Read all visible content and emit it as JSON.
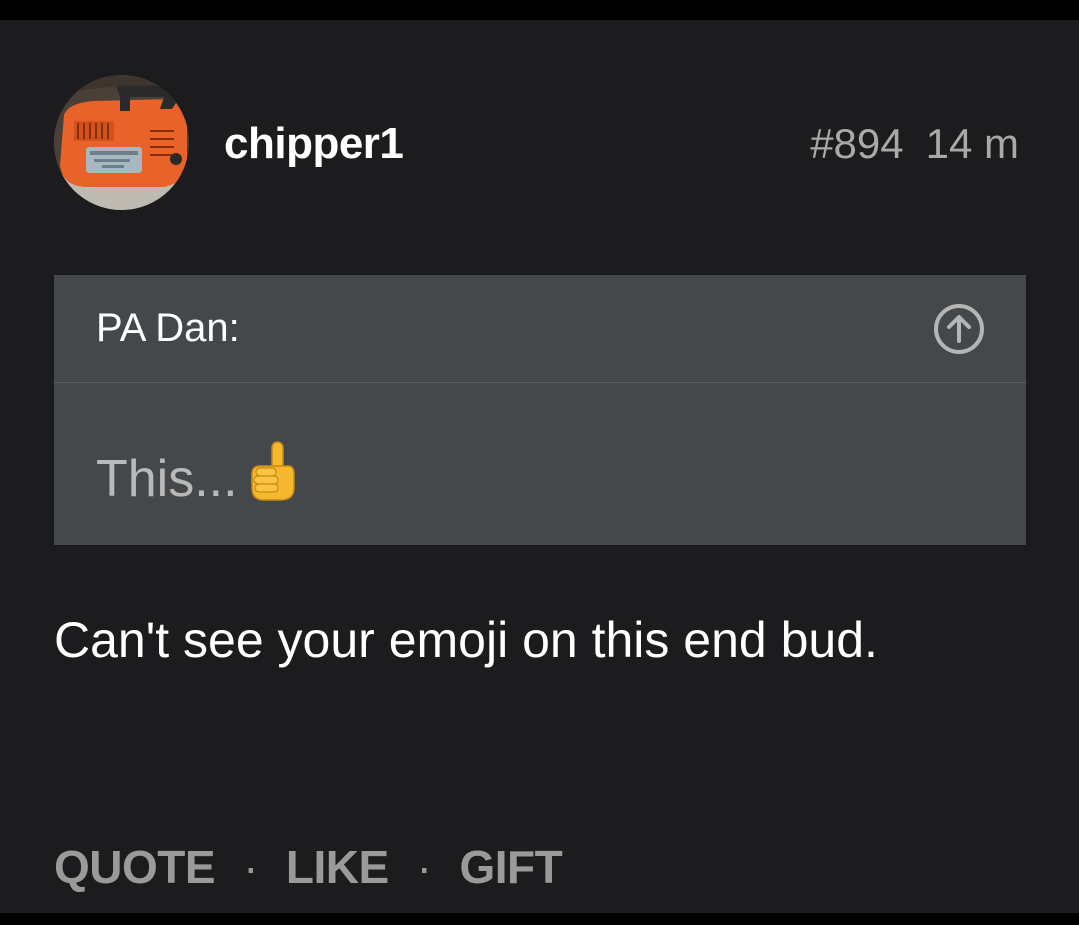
{
  "post": {
    "username": "chipper1",
    "post_number": "#894",
    "time_ago": "14 m",
    "avatar_icon": "chainsaw-avatar",
    "quote": {
      "author": "PA Dan:",
      "text": "This...",
      "emoji_icon": "pointing-up-emoji",
      "jump_icon": "arrow-up-circle-icon"
    },
    "body": "Can't see your emoji on this end bud.",
    "actions": {
      "quote_label": "QUOTE",
      "like_label": "LIKE",
      "gift_label": "GIFT",
      "separator": "·"
    }
  },
  "colors": {
    "background": "#1c1c1e",
    "quote_background": "#45484b",
    "muted_text": "#a9a9a9",
    "accent_orange": "#e8622a"
  }
}
